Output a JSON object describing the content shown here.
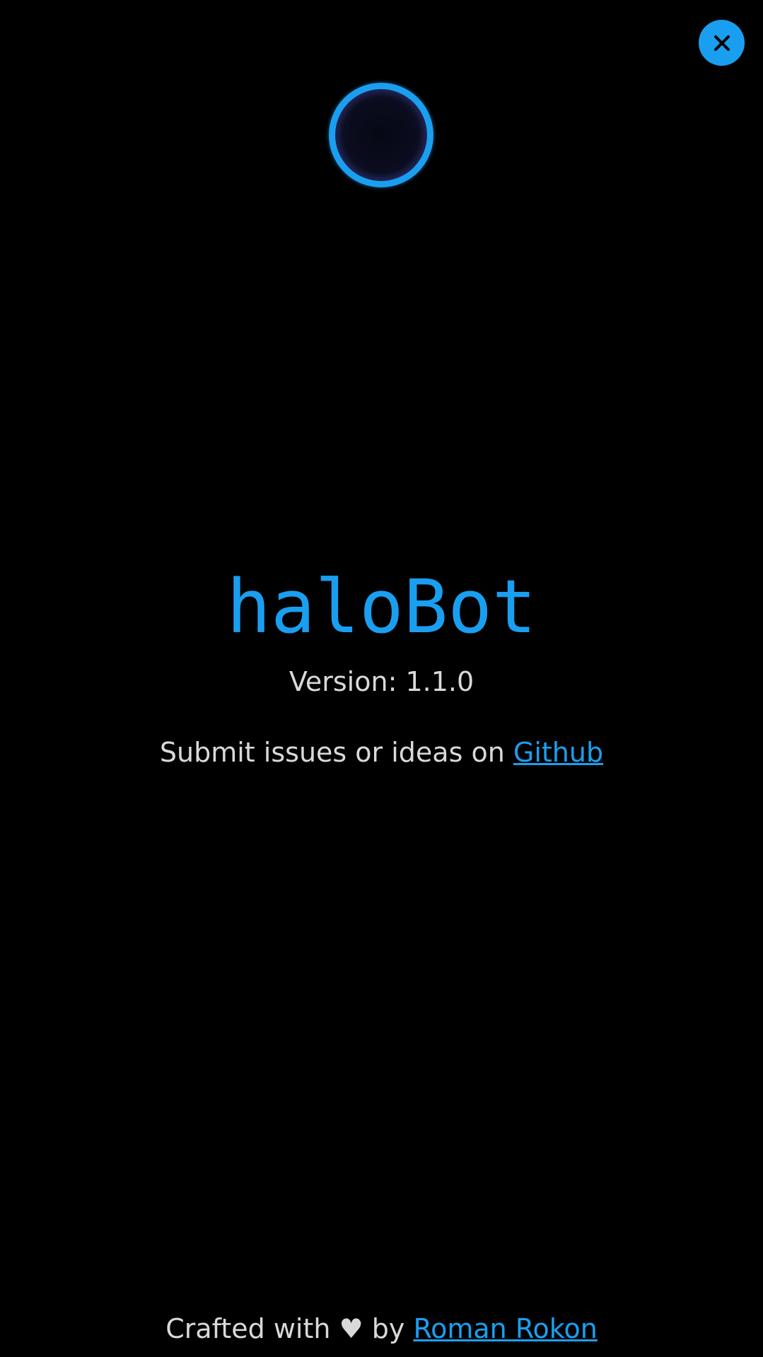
{
  "header": {
    "close_icon": "close-icon"
  },
  "logo": {
    "icon": "halo-ring-icon"
  },
  "app": {
    "title": "haloBot",
    "version_label": "Version:",
    "version_value": "1.1.0"
  },
  "issues": {
    "text": "Submit issues or ideas on",
    "link_label": "Github"
  },
  "footer": {
    "text_before": "Crafted with",
    "heart": "♥",
    "text_by": "by",
    "author_link": "Roman Rokon"
  },
  "colors": {
    "accent": "#1a9ff0",
    "background": "#000000",
    "text": "#d9d9d9"
  }
}
